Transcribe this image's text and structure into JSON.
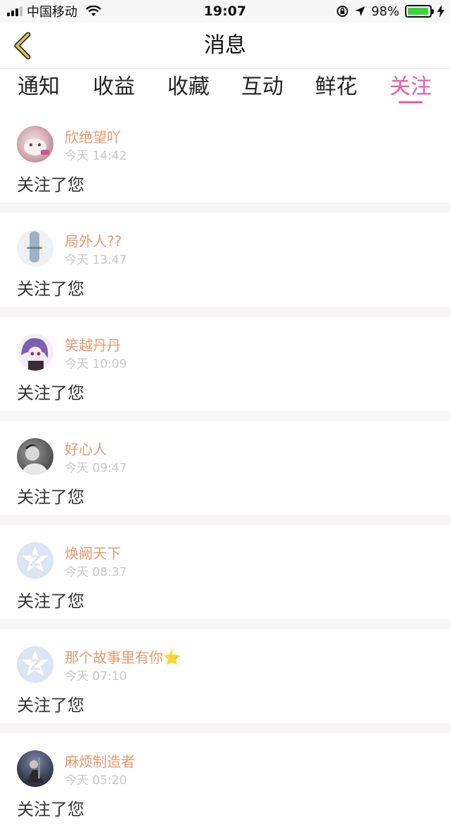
{
  "status_bar": {
    "carrier": "中国移动",
    "time": "19:07",
    "battery_text": "98%",
    "battery_level": 0.98
  },
  "nav": {
    "title": "消息",
    "back_icon": "chevron-left-icon"
  },
  "tabs": [
    {
      "label": "通知",
      "active": false
    },
    {
      "label": "收益",
      "active": false
    },
    {
      "label": "收藏",
      "active": false
    },
    {
      "label": "互动",
      "active": false
    },
    {
      "label": "鲜花",
      "active": false
    },
    {
      "label": "关注",
      "active": true
    }
  ],
  "colors": {
    "accent": "#ee5aa0",
    "username": "#e69a6e",
    "back_icon": "#e2c84a",
    "battery": "#3ed23e"
  },
  "items": [
    {
      "user": "欣绝望吖",
      "time": "今天 14:42",
      "message": "关注了您",
      "avatar": "photo-avatar-pink"
    },
    {
      "user": "局外人??",
      "time": "今天 13:47",
      "message": "关注了您",
      "avatar": "photo-avatar-light"
    },
    {
      "user": "笑越丹丹",
      "time": "今天 10:09",
      "message": "关注了您",
      "avatar": "anime-avatar"
    },
    {
      "user": "好心人",
      "time": "今天 09:47",
      "message": "关注了您",
      "avatar": "photo-avatar-gray"
    },
    {
      "user": "焕阙天下",
      "time": "今天 08:37",
      "message": "关注了您",
      "avatar": "default-qzone-avatar"
    },
    {
      "user": "那个故事里有你⭐",
      "time": "今天 07:10",
      "message": "关注了您",
      "avatar": "default-qzone-avatar"
    },
    {
      "user": "麻烦制造者",
      "time": "今天 05:20",
      "message": "关注了您",
      "avatar": "photo-avatar-dark"
    }
  ]
}
